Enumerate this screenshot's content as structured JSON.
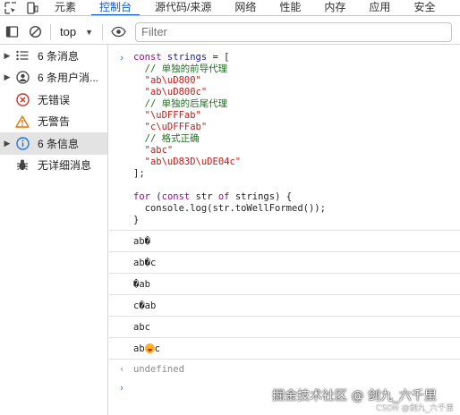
{
  "tabbar": {
    "tabs": [
      "元素",
      "控制台",
      "源代码/来源",
      "网络",
      "性能",
      "内存",
      "应用",
      "安全"
    ],
    "active": "控制台"
  },
  "toolbar": {
    "context": "top",
    "filter_placeholder": "Filter"
  },
  "sidebar": {
    "items": [
      {
        "label": "6 条消息",
        "icon": "list-icon",
        "expandable": true
      },
      {
        "label": "6 条用户消...",
        "icon": "user-icon",
        "expandable": true
      },
      {
        "label": "无错误",
        "icon": "error-icon",
        "expandable": false
      },
      {
        "label": "无警告",
        "icon": "warning-icon",
        "expandable": false
      },
      {
        "label": "6 条信息",
        "icon": "info-icon",
        "expandable": true
      },
      {
        "label": "无详细消息",
        "icon": "bug-icon",
        "expandable": false
      }
    ],
    "selected_index": 4
  },
  "console": {
    "code": {
      "l1_kw": "const",
      "l1_var": " strings",
      "l1_rest": " = [",
      "l2": "  // 单独的前导代理",
      "l3": "  \"ab\\uD800\"",
      "l4": "  \"ab\\uD800c\"",
      "l5": "  // 单独的后尾代理",
      "l6": "  \"\\uDFFFab\"",
      "l7": "  \"c\\uDFFFab\"",
      "l8": "  // 格式正确",
      "l9": "  \"abc\"",
      "l10": "  \"ab\\uD83D\\uDE04c\"",
      "l11": "];",
      "l13_for": "for",
      "l13_mid": " (",
      "l13_const": "const",
      "l13_str": " str ",
      "l13_of": "of",
      "l13_rest": " strings) {",
      "l14": "  console.log(str.toWellFormed());",
      "l15": "}"
    },
    "outputs": [
      "ab�",
      "ab�c",
      "�ab",
      "c�ab",
      "abc"
    ],
    "emoji_output": {
      "before": "ab",
      "after": "c"
    },
    "return_value": "undefined"
  },
  "watermark": {
    "main": "掘金技术社区 @ 剑九_六千里",
    "sub": "CSDN @剑九_六千里"
  },
  "colors": {
    "accent": "#0b57d0",
    "keyword": "#881280",
    "string": "#c41a16",
    "comment": "#236e25",
    "error": "#d93025",
    "warning": "#e37400",
    "info": "#1a73e8"
  }
}
